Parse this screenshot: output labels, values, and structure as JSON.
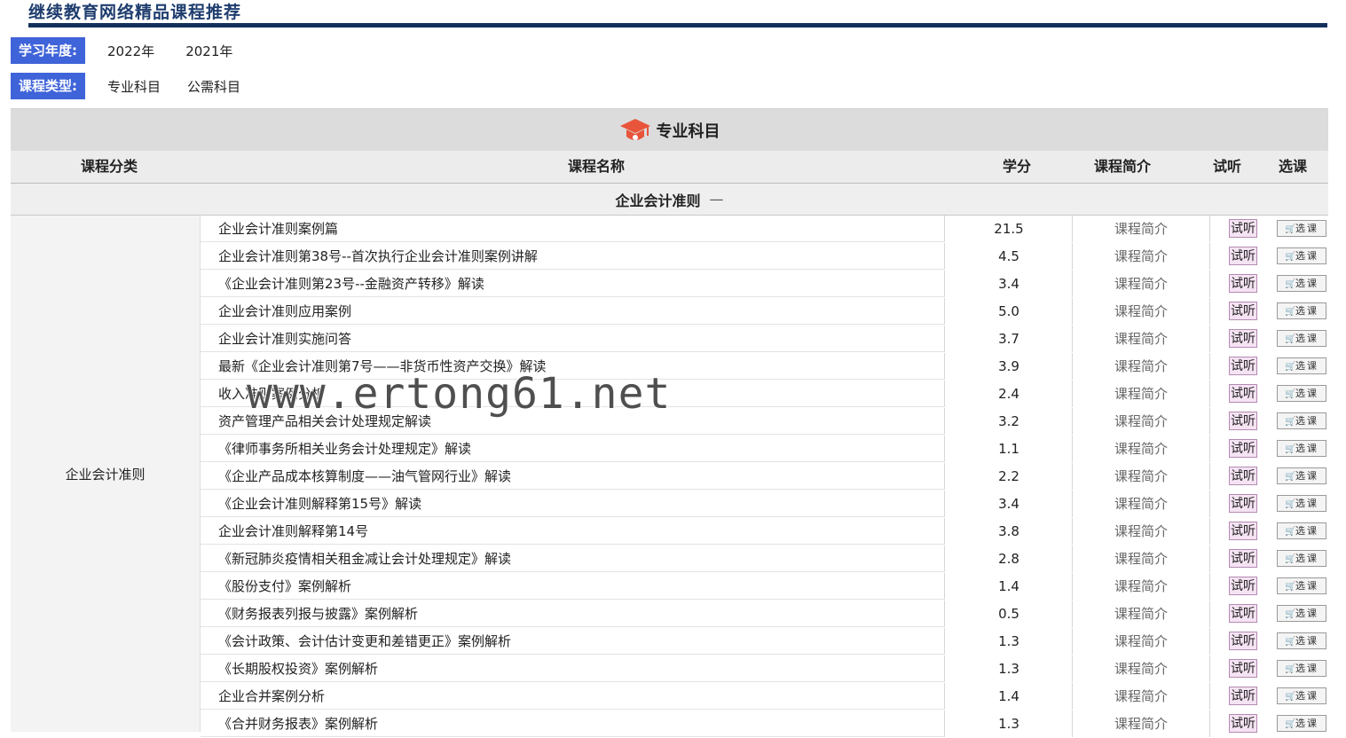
{
  "page": {
    "title": "继续教育网络精品课程推荐"
  },
  "filters": {
    "year": {
      "label": "学习年度:",
      "options": [
        "2022年",
        "2021年"
      ]
    },
    "type": {
      "label": "课程类型:",
      "options": [
        "专业科目",
        "公需科目"
      ]
    }
  },
  "section": {
    "title": "专业科目",
    "icon": "graduation-cap-icon"
  },
  "columns": {
    "category": "课程分类",
    "name": "课程名称",
    "credit": "学分",
    "intro": "课程简介",
    "listen": "试听",
    "select": "选课"
  },
  "group": {
    "title": "企业会计准则",
    "collapse": "—"
  },
  "category_label": "企业会计准则",
  "row_labels": {
    "intro": "课程简介",
    "listen": "试听",
    "select": "选课",
    "select_icon": "cart-icon"
  },
  "rows": [
    {
      "name": "企业会计准则案例篇",
      "credit": "21.5"
    },
    {
      "name": "企业会计准则第38号--首次执行企业会计准则案例讲解",
      "credit": "4.5"
    },
    {
      "name": "《企业会计准则第23号--金融资产转移》解读",
      "credit": "3.4"
    },
    {
      "name": "企业会计准则应用案例",
      "credit": "5.0"
    },
    {
      "name": "企业会计准则实施问答",
      "credit": "3.7"
    },
    {
      "name": "最新《企业会计准则第7号——非货币性资产交换》解读",
      "credit": "3.9"
    },
    {
      "name": "收入准则案例分析",
      "credit": "2.4"
    },
    {
      "name": "资产管理产品相关会计处理规定解读",
      "credit": "3.2"
    },
    {
      "name": "《律师事务所相关业务会计处理规定》解读",
      "credit": "1.1"
    },
    {
      "name": "《企业产品成本核算制度——油气管网行业》解读",
      "credit": "2.2"
    },
    {
      "name": "《企业会计准则解释第15号》解读",
      "credit": "3.4"
    },
    {
      "name": "企业会计准则解释第14号",
      "credit": "3.8"
    },
    {
      "name": "《新冠肺炎疫情相关租金减让会计处理规定》解读",
      "credit": "2.8"
    },
    {
      "name": "《股份支付》案例解析",
      "credit": "1.4"
    },
    {
      "name": "《财务报表列报与披露》案例解析",
      "credit": "0.5"
    },
    {
      "name": "《会计政策、会计估计变更和差错更正》案例解析",
      "credit": "1.3"
    },
    {
      "name": "《长期股权投资》案例解析",
      "credit": "1.3"
    },
    {
      "name": "企业合并案例分析",
      "credit": "1.4"
    },
    {
      "name": "《合并财务报表》案例解析",
      "credit": "1.3"
    }
  ],
  "watermark": "www.ertong61.net"
}
